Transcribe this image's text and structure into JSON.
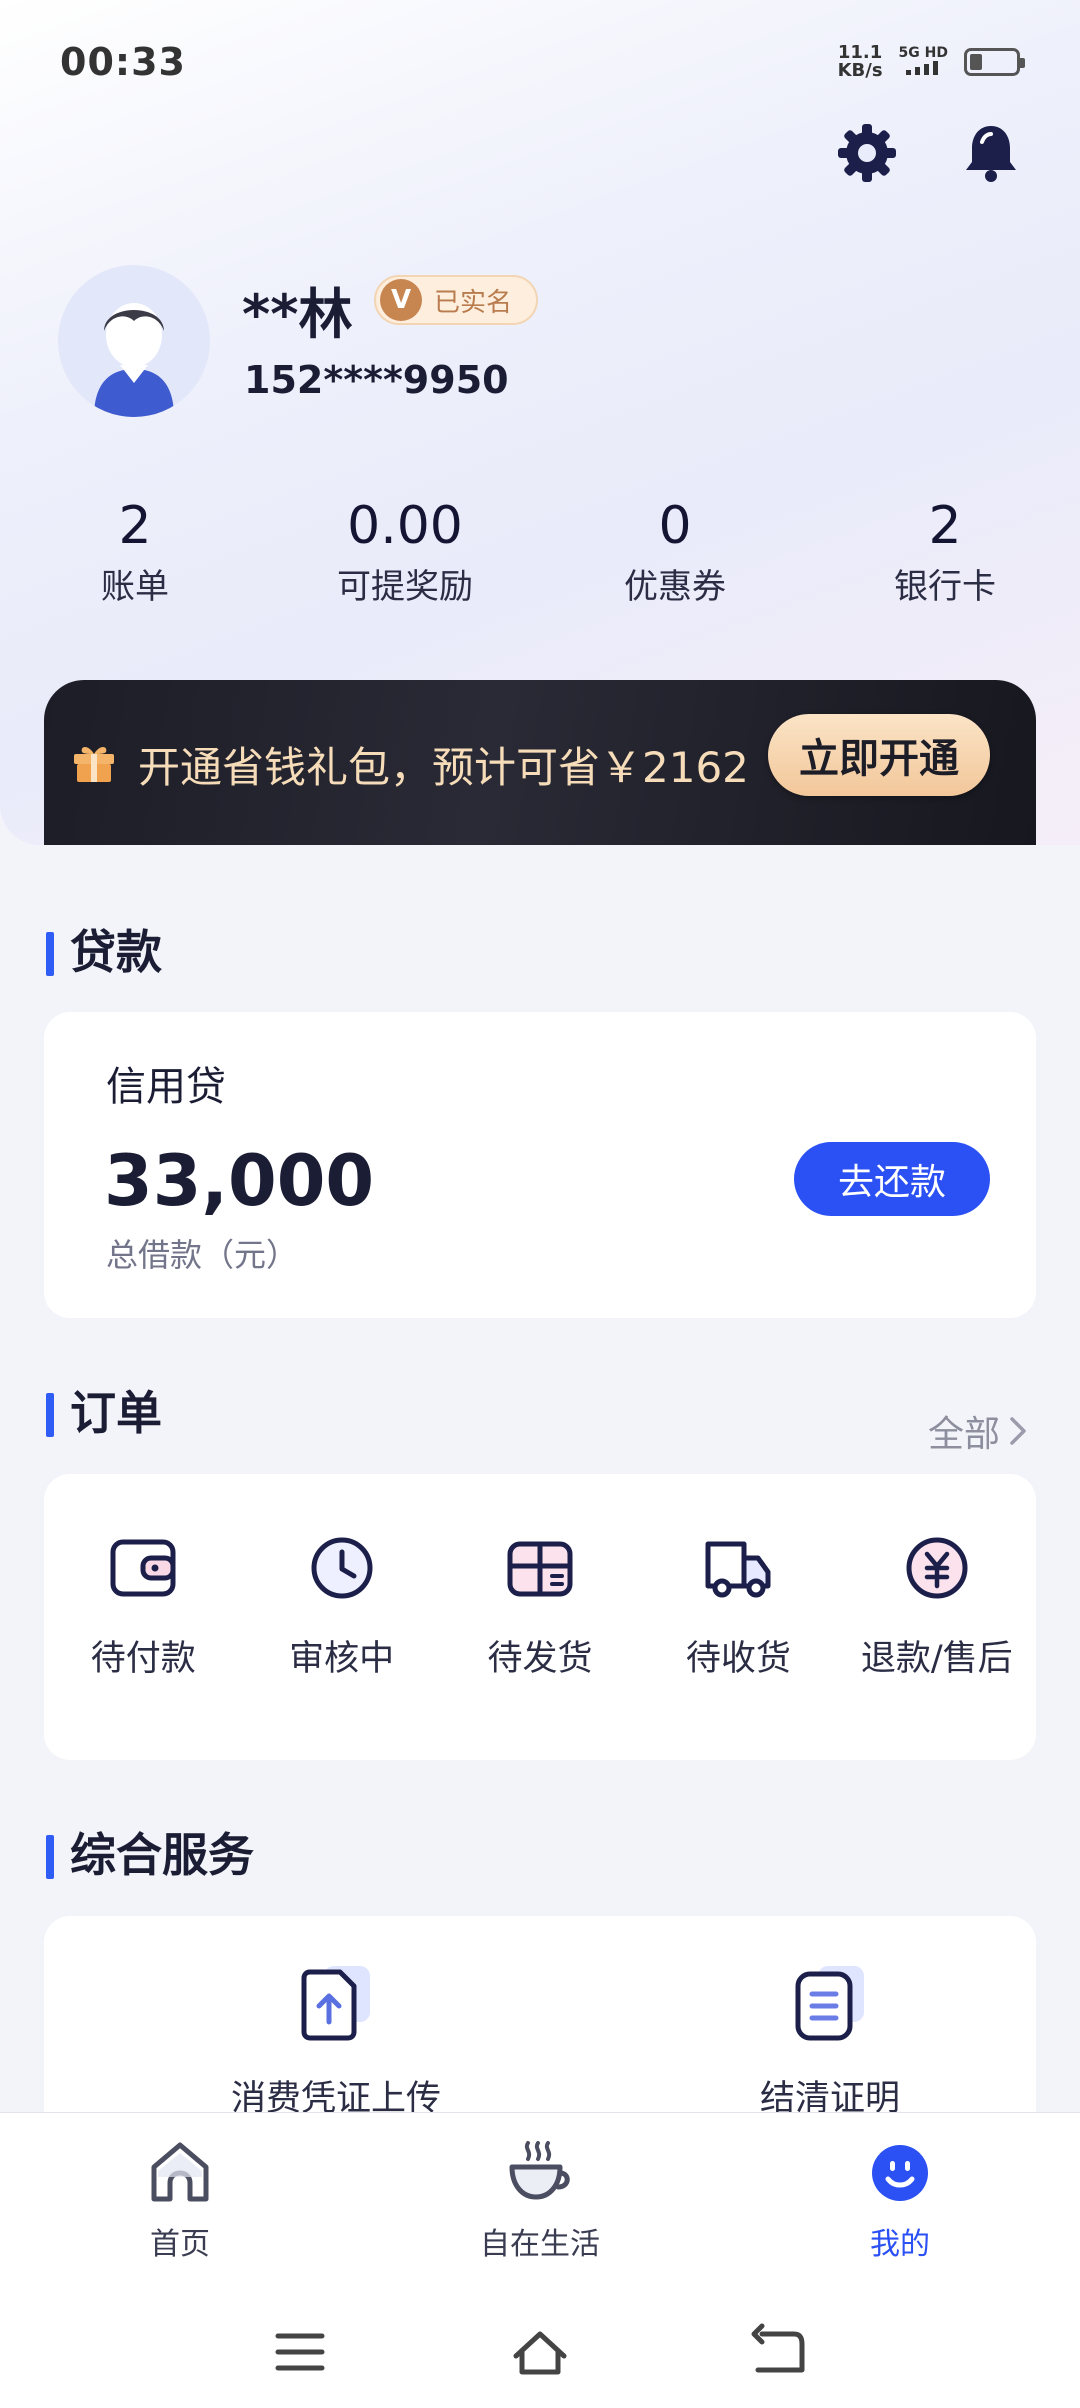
{
  "status_bar": {
    "time": "00:33",
    "net_speed_value": "11.1",
    "net_speed_unit": "KB/s",
    "network": "5G HD"
  },
  "top_icons": [
    "gear-icon",
    "bell-icon"
  ],
  "user": {
    "name": "**林",
    "verify_mark": "V",
    "verify_label": "已实名",
    "phone": "152****9950"
  },
  "stats": [
    {
      "value": "2",
      "label": "账单"
    },
    {
      "value": "0.00",
      "label": "可提奖励"
    },
    {
      "value": "0",
      "label": "优惠券"
    },
    {
      "value": "2",
      "label": "银行卡"
    }
  ],
  "promo": {
    "text": "开通省钱礼包，预计可省￥2162",
    "button": "立即开通"
  },
  "loan": {
    "section_title": "贷款",
    "type": "信用贷",
    "amount": "33,000",
    "amount_label": "总借款（元）",
    "repay_button": "去还款"
  },
  "orders": {
    "section_title": "订单",
    "view_all": "全部",
    "items": [
      {
        "label": "待付款",
        "icon": "wallet-icon"
      },
      {
        "label": "审核中",
        "icon": "clock-icon"
      },
      {
        "label": "待发货",
        "icon": "box-icon"
      },
      {
        "label": "待收货",
        "icon": "truck-icon"
      },
      {
        "label": "退款/售后",
        "icon": "refund-icon"
      }
    ]
  },
  "services": {
    "section_title": "综合服务",
    "items": [
      {
        "label": "消费凭证上传",
        "icon": "upload-doc-icon"
      },
      {
        "label": "结清证明",
        "icon": "certificate-icon"
      }
    ]
  },
  "bottom_nav": [
    {
      "label": "首页",
      "icon": "home-icon",
      "active": false
    },
    {
      "label": "自在生活",
      "icon": "coffee-icon",
      "active": false
    },
    {
      "label": "我的",
      "icon": "smile-icon",
      "active": true
    }
  ],
  "colors": {
    "accent": "#2b51f4",
    "promo_bg": "#1d1d27",
    "promo_text": "#f6dcb8",
    "icon_navy": "#1c1f4a"
  }
}
